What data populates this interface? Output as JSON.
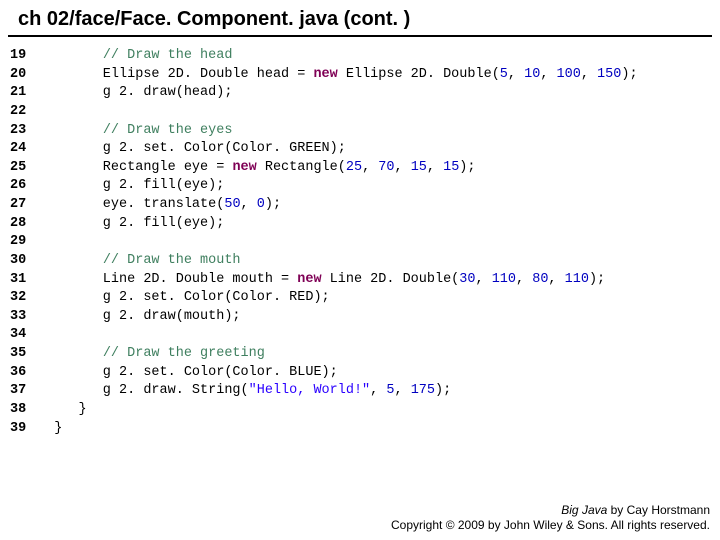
{
  "title": "ch 02/face/Face. Component. java (cont. )",
  "line_numbers": "19\n20\n21\n22\n23\n24\n25\n26\n27\n28\n29\n30\n31\n32\n33\n34\n35\n36\n37\n38\n39",
  "code": {
    "c_head": "// Draw the head",
    "l20a": "      Ellipse 2D. Double head = ",
    "kw_new1": "new",
    "l20b": " Ellipse 2D. Double(",
    "n5": "5",
    "n10": "10",
    "n100": "100",
    "n150": "150",
    "l20c": ");",
    "l21": "      g 2. draw(head);",
    "c_eyes": "// Draw the eyes",
    "l24": "      g 2. set. Color(Color. GREEN);",
    "l25a": "      Rectangle eye = ",
    "kw_new2": "new",
    "l25b": " Rectangle(",
    "n25": "25",
    "n70": "70",
    "n15": "15",
    "n15b": "15",
    "l26": "      g 2. fill(eye);",
    "l27a": "      eye. translate(",
    "n50": "50",
    "n0": "0",
    "l28": "      g 2. fill(eye);",
    "c_mouth": "// Draw the mouth",
    "l31a": "      Line 2D. Double mouth = ",
    "kw_new3": "new",
    "l31b": " Line 2D. Double(",
    "n30": "30",
    "n110": "110",
    "n80": "80",
    "n110b": "110",
    "l32": "      g 2. set. Color(Color. RED);",
    "l33": "      g 2. draw(mouth);",
    "c_greet": "// Draw the greeting",
    "l36": "      g 2. set. Color(Color. BLUE);",
    "l37a": "      g 2. draw. String(",
    "str": "\"Hello, World!\"",
    "n5b": "5",
    "n175": "175",
    "brace1": "   }",
    "brace2": "}"
  },
  "footer": {
    "line1a": "Big Java",
    "line1b": " by Cay Horstmann",
    "line2": "Copyright © 2009 by John Wiley & Sons. All rights reserved."
  },
  "sep": ", "
}
